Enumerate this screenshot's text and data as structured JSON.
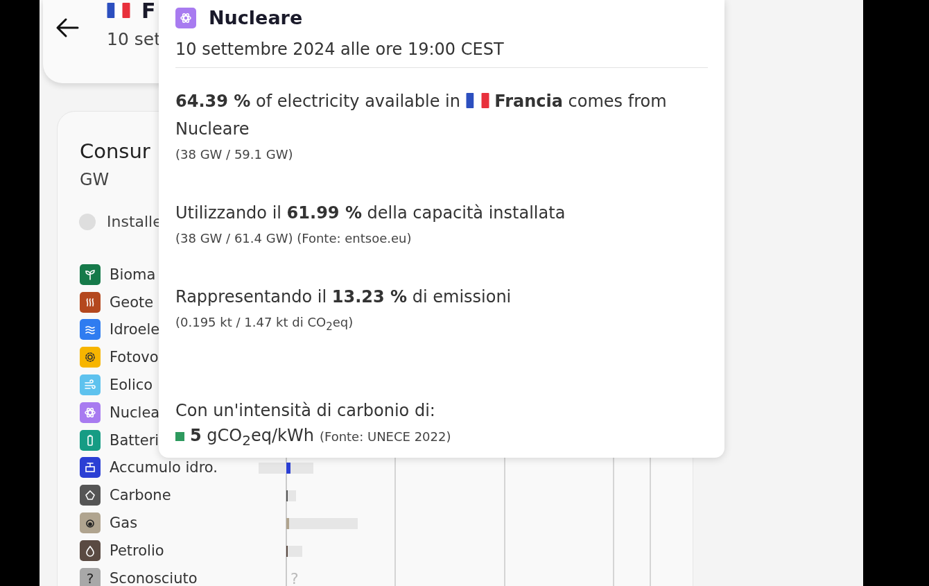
{
  "header": {
    "title": "F",
    "date": "10 set"
  },
  "card": {
    "title": "Consur",
    "unit": "GW",
    "installed_toggle": {
      "label": "Installe",
      "checked": false
    }
  },
  "legend": [
    {
      "kind": "biomass",
      "label": "Bioma",
      "color": "#167a4a"
    },
    {
      "kind": "geothermal",
      "label": "Geote",
      "color": "#b4481e"
    },
    {
      "kind": "hydro",
      "label": "Idroele",
      "color": "#2f7cf0"
    },
    {
      "kind": "solar",
      "label": "Fotovo",
      "color": "#f7b500"
    },
    {
      "kind": "wind",
      "label": "Eolico",
      "color": "#5ec2ee"
    },
    {
      "kind": "nuclear",
      "label": "Nuclea",
      "color": "#a87bf0"
    },
    {
      "kind": "battery",
      "label": "Batteri",
      "color": "#169c84"
    },
    {
      "kind": "hydro_storage",
      "label": "Accumulo idro.",
      "color": "#2b3fd4"
    },
    {
      "kind": "coal",
      "label": "Carbone",
      "color": "#555555"
    },
    {
      "kind": "gas",
      "label": "Gas",
      "color": "#b0a48f"
    },
    {
      "kind": "oil",
      "label": "Petrolio",
      "color": "#5a4a42"
    },
    {
      "kind": "unknown",
      "label": "Sconosciuto",
      "color": "#a8a8a8",
      "glyph": "?",
      "bar_label": "?"
    }
  ],
  "tooltip": {
    "title": "Nucleare",
    "date": "10 settembre 2024 alle ore 19:00 CEST",
    "share_before_flag": "**64.39 %** of electricity available in",
    "share_after_flag": "**Francia** comes from",
    "share_last_line": "Nucleare",
    "share_detail": "(38 GW / 59.1 GW)",
    "capacity": "Utilizzando il **61.99 %** della capacità installata",
    "capacity_detail": "(38 GW / 61.4 GW) (Fonte: entsoe.eu)",
    "emissions": "Rappresentando il **13.23 %** di emissioni",
    "emissions_detail": "(0.195 kt / 1.47 kt di CO$_{2}$eq)",
    "intensity_label": "Con un'intensità di carbonio di:",
    "intensity_value": "**5** gCO$_{2}$eq/kWh",
    "intensity_source": "(Fonte: UNECE 2022)"
  }
}
